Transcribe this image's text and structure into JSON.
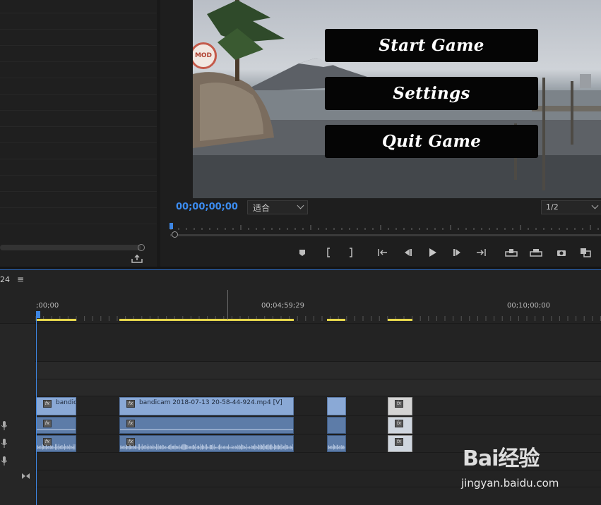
{
  "program_monitor": {
    "timecode": "00;00;00;00",
    "zoom_select": "适合",
    "resolution_select": "1/2",
    "game_menu": {
      "start_label": "Start Game",
      "settings_label": "Settings",
      "quit_label": "Quit Game"
    },
    "logo_text": "MOD",
    "transport_icons": [
      "marker-icon",
      "mark-in-icon",
      "mark-out-icon",
      "go-to-in-icon",
      "step-back-icon",
      "play-icon",
      "step-forward-icon",
      "go-to-out-icon",
      "lift-icon",
      "extract-icon",
      "export-frame-icon",
      "compare-view-icon"
    ]
  },
  "timeline": {
    "title": "24",
    "menu_icon": "≡",
    "timecodes": {
      "start": ";00;00",
      "mid": "00;04;59;29",
      "end": "00;10;00;00"
    },
    "clips": {
      "v1_short_label": "bandica",
      "v1_main_label": "bandicam 2018-07-13 20-58-44-924.mp4 [V]"
    },
    "accent_color": "#3e86e3",
    "work_area_color": "#e8d84c"
  },
  "watermark": {
    "logo": "Bai经验",
    "url": "jingyan.baidu.com"
  }
}
